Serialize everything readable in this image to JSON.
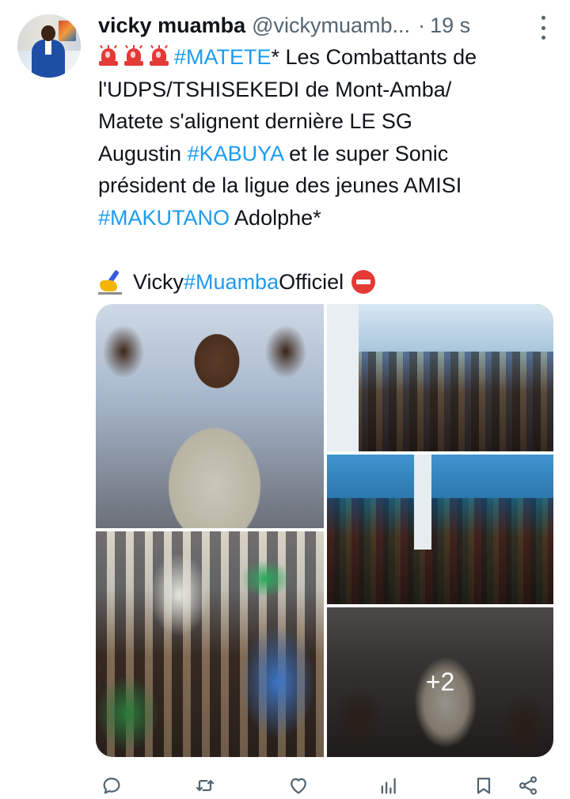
{
  "tweet": {
    "author_name": "vicky muamba",
    "author_handle": "@vickymuamb...",
    "separator": "·",
    "timestamp": "19 s",
    "lines": [
      [
        {
          "t": "alarm",
          "v": "🚨"
        },
        {
          "t": "alarm",
          "v": "🚨"
        },
        {
          "t": "alarm",
          "v": "🚨"
        },
        {
          "t": "tag",
          "v": "#MATETE"
        },
        {
          "t": "text",
          "v": "* Les Combattants de"
        }
      ],
      [
        {
          "t": "text",
          "v": "l'UDPS/TSHISEKEDI de  Mont-Amba/"
        }
      ],
      [
        {
          "t": "text",
          "v": "Matete s'alignent dernière  LE SG"
        }
      ],
      [
        {
          "t": "text",
          "v": "Augustin "
        },
        {
          "t": "tag",
          "v": "#KABUYA"
        },
        {
          "t": "text",
          "v": " et le super Sonic"
        }
      ],
      [
        {
          "t": "text",
          "v": "président de la ligue des jeunes AMISI"
        }
      ],
      [
        {
          "t": "tag",
          "v": "#MAKUTANO"
        },
        {
          "t": "text",
          "v": " Adolphe*"
        }
      ]
    ],
    "signature": {
      "emoji_pen": "✍",
      "name": "Vicky ",
      "hashtag": "#Muamba",
      "suffix": " Officiel",
      "emoji_stop": "⛔"
    },
    "media": {
      "photo_count": 4,
      "extra_count_label": "+2"
    }
  },
  "actions": [
    {
      "name": "reply-button",
      "icon": "reply-icon"
    },
    {
      "name": "retweet-button",
      "icon": "retweet-icon"
    },
    {
      "name": "like-button",
      "icon": "heart-icon"
    },
    {
      "name": "views-button",
      "icon": "analytics-icon"
    },
    {
      "name": "bookmark-button",
      "icon": "bookmark-icon"
    },
    {
      "name": "share-button",
      "icon": "share-icon"
    }
  ],
  "colors": {
    "text": "#0f1419",
    "secondary": "#536471",
    "link": "#1d9bf0",
    "background": "#ffffff"
  }
}
